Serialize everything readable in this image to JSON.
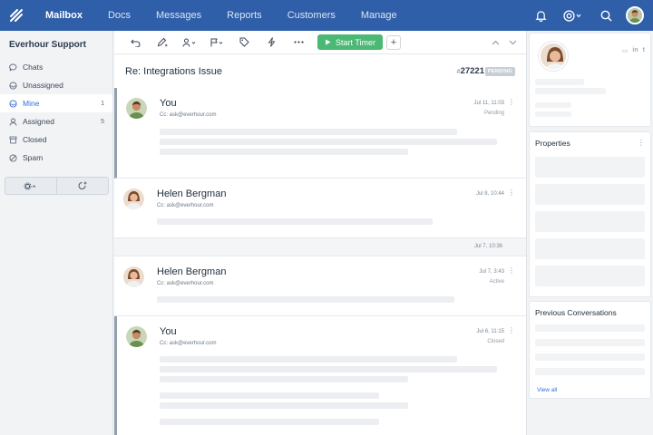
{
  "nav": {
    "items": [
      {
        "label": "Mailbox",
        "active": true
      },
      {
        "label": "Docs"
      },
      {
        "label": "Messages"
      },
      {
        "label": "Reports"
      },
      {
        "label": "Customers"
      },
      {
        "label": "Manage"
      }
    ],
    "icons": [
      "bell-icon",
      "lifebuoy-icon",
      "search-icon"
    ]
  },
  "sidebar": {
    "mailbox_name": "Everhour Support",
    "folders": [
      {
        "label": "Chats",
        "icon": "chat-icon"
      },
      {
        "label": "Unassigned",
        "icon": "inbox-icon"
      },
      {
        "label": "Mine",
        "icon": "user-icon",
        "count": "1",
        "active": true
      },
      {
        "label": "Assigned",
        "icon": "user-icon",
        "count": "5"
      },
      {
        "label": "Closed",
        "icon": "archive-icon"
      },
      {
        "label": "Spam",
        "icon": "block-icon"
      }
    ]
  },
  "toolbar": {
    "timer_label": "Start Timer",
    "plus_label": "+"
  },
  "conversation": {
    "subject": "Re: Integrations Issue",
    "ticket_hash": "#",
    "ticket_number": "27221",
    "status": "PENDING",
    "divider_date": "Jul 7, 10:36",
    "threads": [
      {
        "author": "You",
        "cc": "Cc: ask@everhour.com",
        "date": "Jul 11, 11:03",
        "status": "Pending"
      },
      {
        "author": "Helen Bergman",
        "cc": "Cc: ask@everhour.com",
        "date": "Jul 8, 10:44",
        "status": ""
      },
      {
        "author": "Helen Bergman",
        "cc": "Cc: ask@everhour.com",
        "date": "Jul 7, 3:43",
        "status": "Active"
      },
      {
        "author": "You",
        "cc": "Cc: ask@everhour.com",
        "date": "Jul 6, 11:15",
        "status": "Closed"
      }
    ]
  },
  "right_panel": {
    "properties_title": "Properties",
    "previous_title": "Previous Conversations",
    "view_all": "View all",
    "social": [
      "▭",
      "in",
      "t"
    ]
  },
  "colors": {
    "nav_bg": "#2f5fa8",
    "accent": "#2f6fdd",
    "timer_green": "#4bb974"
  }
}
